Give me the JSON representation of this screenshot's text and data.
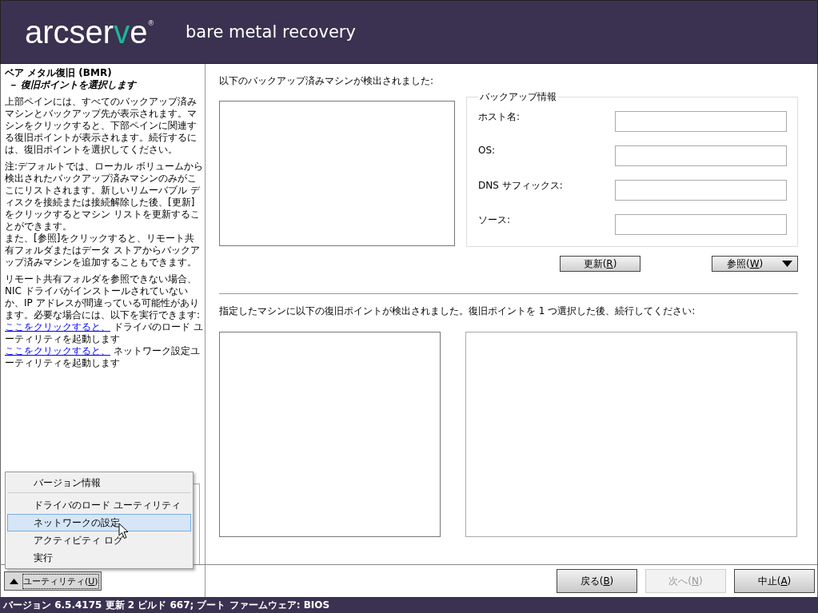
{
  "header": {
    "logo": [
      {
        "text": "arcser",
        "accent": false
      },
      {
        "text": "v",
        "accent": true
      },
      {
        "text": "e",
        "accent": false
      },
      {
        "text": "®",
        "accent": false
      }
    ],
    "title": "bare metal recovery"
  },
  "sidebar": {
    "title": "ベア メタル復旧 (BMR)",
    "subtitle": "－ 復旧ポイントを選択します",
    "paragraphs": [
      {
        "lines": [
          "上部ペインには、すべてのバックアップ済みマシンとバックアップ先が表示されます。マシンをクリックすると、下部ペインに関連する復旧ポイントが表示されます。続行するには、復旧ポイントを選択してください。"
        ]
      },
      {
        "lines": [
          "注:デフォルトでは、ローカル ボリュームから検出されたバックアップ済みマシンのみがここにリストされます。新しいリムーバブル ディスクを接続または接続解除した後、[更新] をクリックするとマシン リストを更新することができます。",
          "また、[参照]をクリックすると、リモート共有フォルダまたはデータ ストアからバックアップ済みマシンを追加することもできます。"
        ]
      },
      {
        "lines": [
          "リモート共有フォルダを参照できない場合、NIC ドライバがインストールされていないか、IP アドレスが間違っている可能性があります。必要な場合には、以下を実行できます:"
        ]
      }
    ],
    "links": [
      {
        "link": "ここをクリックすると、",
        "text": "ドライバのロード ユーティリティを起動します"
      },
      {
        "link": "ここをクリックすると、",
        "text": "ネットワーク設定ユーティリティを起動します"
      }
    ]
  },
  "machines": {
    "label": "以下のバックアップ済みマシンが検出されました:"
  },
  "backup_info": {
    "legend": "バックアップ情報",
    "fields": [
      {
        "label": "ホスト名:"
      },
      {
        "label": "OS:"
      },
      {
        "label": "DNS サフィックス:"
      },
      {
        "label": "ソース:"
      }
    ]
  },
  "machine_buttons": [
    {
      "parts": [
        "更新(",
        "R",
        ")"
      ],
      "kind": "plain"
    },
    {
      "parts": [
        "参照(",
        "W",
        ")"
      ],
      "kind": "dropdown"
    }
  ],
  "recovery_points": {
    "label": "指定したマシンに以下の復旧ポイントが検出されました。復旧ポイントを 1 つ選択した後、続行してください:"
  },
  "utility_menu": {
    "items": [
      {
        "label": "バージョン情報",
        "selected": false,
        "separator_after": true
      },
      {
        "label": "ドライバのロード ユーティリティ",
        "selected": false,
        "separator_after": false
      },
      {
        "label": "ネットワークの設定",
        "selected": true,
        "separator_after": false
      },
      {
        "label": "アクティビティ ログ",
        "selected": false,
        "separator_after": false
      },
      {
        "label": "実行",
        "selected": false,
        "separator_after": false
      }
    ]
  },
  "utility_button": {
    "parts": [
      "ユーティリティ(",
      "U",
      ")"
    ],
    "expanded": true
  },
  "nav_buttons": [
    {
      "parts": [
        "戻る(",
        "B",
        ")"
      ],
      "disabled": false
    },
    {
      "parts": [
        "次へ(",
        "N",
        ")"
      ],
      "disabled": true
    },
    {
      "parts": [
        "中止(",
        "A",
        ")"
      ],
      "disabled": false
    }
  ],
  "status_bar": "バージョン 6.5.4175 更新 2 ビルド 667; ブート ファームウェア: BIOS"
}
